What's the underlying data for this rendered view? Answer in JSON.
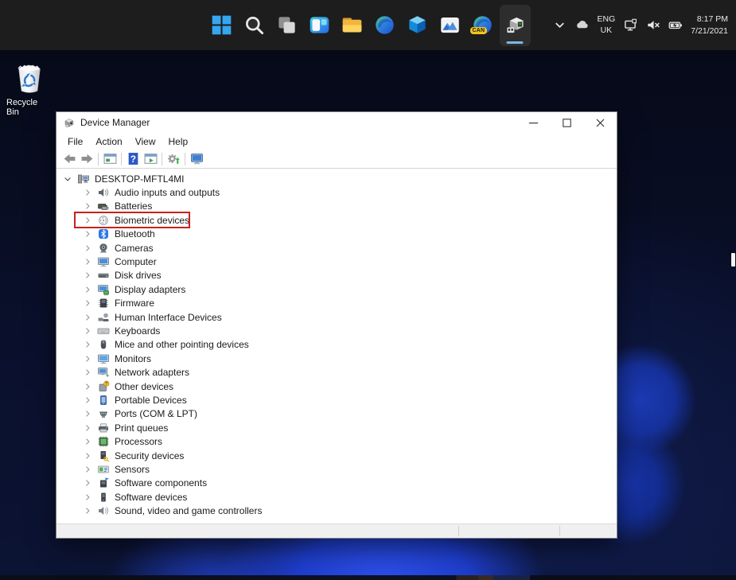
{
  "colors": {
    "taskbar_bg": "#1d1d1d",
    "active_indicator": "#7ab8e8",
    "highlight_red": "#c9211b",
    "desktop_base": "#0a102c",
    "bloom_blue": "#2e52ec"
  },
  "taskbar": {
    "icons": [
      {
        "name": "start"
      },
      {
        "name": "search"
      },
      {
        "name": "task-view"
      },
      {
        "name": "widgets"
      },
      {
        "name": "file-explorer"
      },
      {
        "name": "edge"
      },
      {
        "name": "3d-viewer"
      },
      {
        "name": "photos"
      },
      {
        "name": "edge-canary",
        "badge": "CAN"
      },
      {
        "name": "device-manager",
        "active": true
      }
    ],
    "tray": {
      "language_line1": "ENG",
      "language_line2": "UK",
      "time": "8:17 PM",
      "date": "7/21/2021",
      "icons": [
        "tray-chevron",
        "onedrive",
        "network",
        "volume-muted",
        "battery"
      ]
    }
  },
  "desktop": {
    "recycle_bin_label": "Recycle Bin"
  },
  "window": {
    "title": "Device Manager",
    "menu": [
      "File",
      "Action",
      "View",
      "Help"
    ],
    "toolbar_groups": [
      [
        "back",
        "forward"
      ],
      [
        "console-tree"
      ],
      [
        "help",
        "action-pane"
      ],
      [
        "scan-hardware"
      ],
      [
        "remote-computer"
      ]
    ],
    "tree": {
      "root": {
        "label": "DESKTOP-MFTL4MI",
        "icon": "computer-root",
        "expanded": true
      },
      "items": [
        {
          "label": "Audio inputs and outputs",
          "icon": "audio"
        },
        {
          "label": "Batteries",
          "icon": "battery-cat"
        },
        {
          "label": "Biometric devices",
          "icon": "biometric",
          "highlighted": true
        },
        {
          "label": "Bluetooth",
          "icon": "bluetooth"
        },
        {
          "label": "Cameras",
          "icon": "camera"
        },
        {
          "label": "Computer",
          "icon": "computer-monitor"
        },
        {
          "label": "Disk drives",
          "icon": "disk"
        },
        {
          "label": "Display adapters",
          "icon": "display-adapter"
        },
        {
          "label": "Firmware",
          "icon": "firmware"
        },
        {
          "label": "Human Interface Devices",
          "icon": "hid"
        },
        {
          "label": "Keyboards",
          "icon": "keyboard"
        },
        {
          "label": "Mice and other pointing devices",
          "icon": "mouse"
        },
        {
          "label": "Monitors",
          "icon": "monitor"
        },
        {
          "label": "Network adapters",
          "icon": "network-adapter"
        },
        {
          "label": "Other devices",
          "icon": "other-device"
        },
        {
          "label": "Portable Devices",
          "icon": "portable"
        },
        {
          "label": "Ports (COM & LPT)",
          "icon": "ports"
        },
        {
          "label": "Print queues",
          "icon": "printer"
        },
        {
          "label": "Processors",
          "icon": "processor"
        },
        {
          "label": "Security devices",
          "icon": "security"
        },
        {
          "label": "Sensors",
          "icon": "sensors"
        },
        {
          "label": "Software components",
          "icon": "software-component"
        },
        {
          "label": "Software devices",
          "icon": "software-device"
        },
        {
          "label": "Sound, video and game controllers",
          "icon": "sound"
        }
      ]
    }
  }
}
